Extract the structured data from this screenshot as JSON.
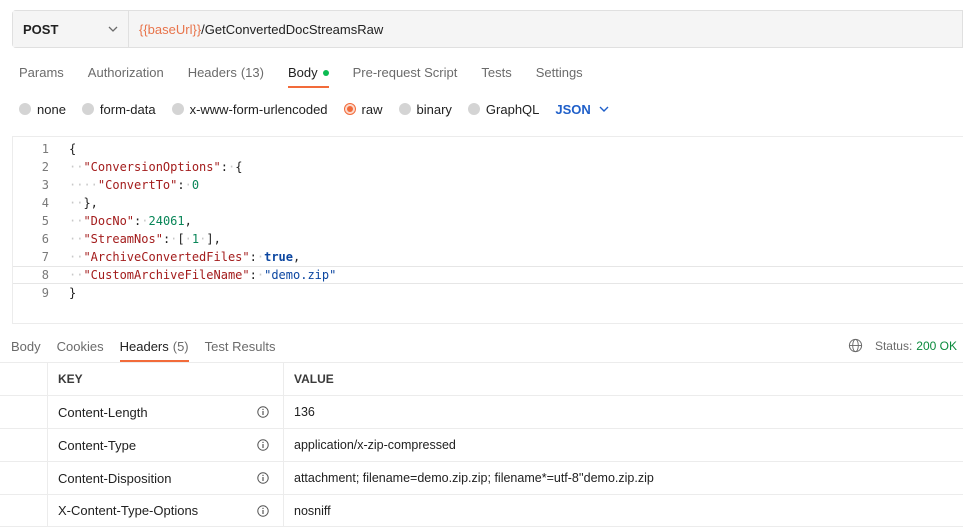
{
  "request": {
    "method": "POST",
    "url_var": "{{baseUrl}}",
    "url_path": "/GetConvertedDocStreamsRaw"
  },
  "request_tabs": [
    {
      "label": "Params",
      "count": ""
    },
    {
      "label": "Authorization",
      "count": ""
    },
    {
      "label": "Headers",
      "count": "(13)"
    },
    {
      "label": "Body",
      "count": ""
    },
    {
      "label": "Pre-request Script",
      "count": ""
    },
    {
      "label": "Tests",
      "count": ""
    },
    {
      "label": "Settings",
      "count": ""
    }
  ],
  "body_types": [
    "none",
    "form-data",
    "x-www-form-urlencoded",
    "raw",
    "binary",
    "GraphQL"
  ],
  "body_language": "JSON",
  "editor": {
    "line_numbers": [
      "1",
      "2",
      "3",
      "4",
      "5",
      "6",
      "7",
      "8",
      "9"
    ],
    "tokens": {
      "open_brace": "{",
      "close_brace": "}",
      "key_conversion": "\"ConversionOptions\"",
      "key_convertto": "\"ConvertTo\"",
      "val_convertto": "0",
      "key_docno": "\"DocNo\"",
      "val_docno": "24061",
      "key_streamnos": "\"StreamNos\"",
      "val_streamnos": "1",
      "key_archive": "\"ArchiveConvertedFiles\"",
      "val_archive": "true",
      "key_custom": "\"CustomArchiveFileName\"",
      "val_custom": "\"demo.zip\""
    }
  },
  "response_tabs": [
    {
      "label": "Body",
      "count": ""
    },
    {
      "label": "Cookies",
      "count": ""
    },
    {
      "label": "Headers",
      "count": "(5)"
    },
    {
      "label": "Test Results",
      "count": ""
    }
  ],
  "status": {
    "label": "Status:",
    "value": "200 OK"
  },
  "headers_table": {
    "col_key": "KEY",
    "col_value": "VALUE",
    "rows": [
      {
        "key": "Content-Length",
        "value": "136"
      },
      {
        "key": "Content-Type",
        "value": "application/x-zip-compressed"
      },
      {
        "key": "Content-Disposition",
        "value": "attachment; filename=demo.zip.zip; filename*=utf-8''demo.zip.zip"
      },
      {
        "key": "X-Content-Type-Options",
        "value": "nosniff"
      }
    ]
  },
  "colors": {
    "accent": "#f26b3a",
    "url_var": "#e8744b",
    "status_ok": "#0a8a3c",
    "language": "#1f5fc9"
  }
}
